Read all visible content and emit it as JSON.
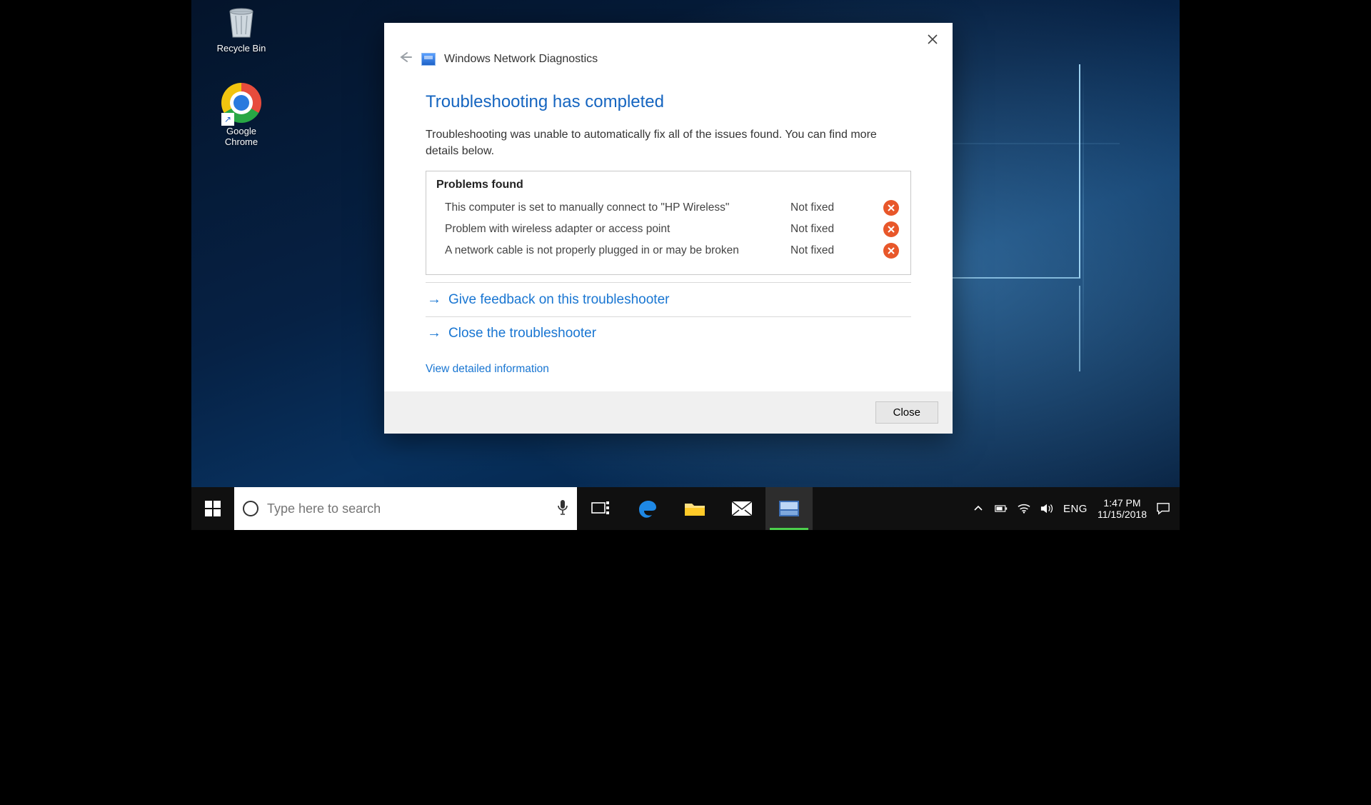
{
  "desktop": {
    "icons": [
      {
        "name": "recycle-bin",
        "label": "Recycle Bin"
      },
      {
        "name": "google-chrome",
        "label": "Google\nChrome"
      }
    ]
  },
  "dialog": {
    "app_title": "Windows Network Diagnostics",
    "heading": "Troubleshooting has completed",
    "lead": "Troubleshooting was unable to automatically fix all of the issues found. You can find more details below.",
    "problems_heading": "Problems found",
    "problems": [
      {
        "desc": "This computer is set to manually connect to \"HP Wireless\"",
        "status": "Not fixed"
      },
      {
        "desc": "Problem with wireless adapter or access point",
        "status": "Not fixed"
      },
      {
        "desc": "A network cable is not properly plugged in or may be broken",
        "status": "Not fixed"
      }
    ],
    "action_feedback": "Give feedback on this troubleshooter",
    "action_close": "Close the troubleshooter",
    "detail_link": "View detailed information",
    "close_button": "Close"
  },
  "taskbar": {
    "search_placeholder": "Type here to search",
    "language": "ENG",
    "time": "1:47 PM",
    "date": "11/15/2018"
  }
}
